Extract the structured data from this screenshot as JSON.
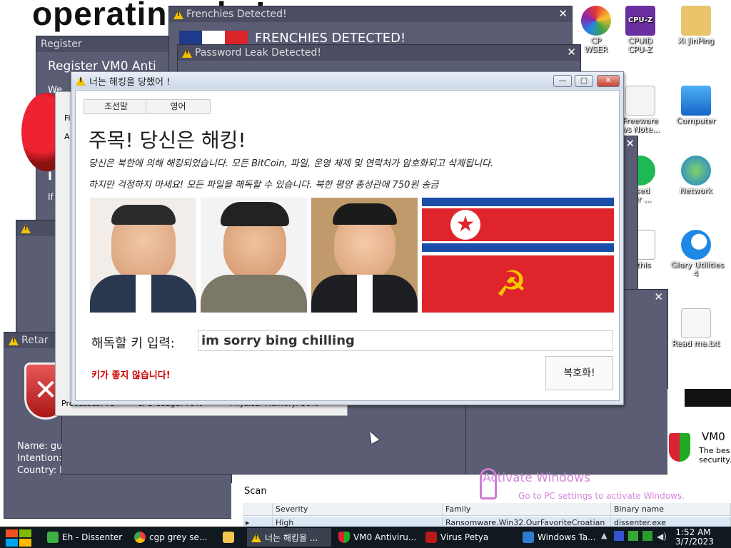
{
  "background_title": "operatin                     ucks!",
  "desktop_icons": [
    {
      "label": "CP\nWSER",
      "icon": "browser-icon"
    },
    {
      "label": "CPUID\nCPU-Z",
      "icon": "cpuz-icon"
    },
    {
      "label": "Xi JinPing",
      "icon": "folder-user-icon"
    },
    {
      "label": "Freeware\nws Note...",
      "icon": "document-icon"
    },
    {
      "label": "Computer",
      "icon": "computer-icon"
    },
    {
      "label": "used\nser ...",
      "icon": "spotify-icon"
    },
    {
      "label": "Network",
      "icon": "network-icon"
    },
    {
      "label": "s this",
      "icon": "file-icon"
    },
    {
      "label": "Glary Utilities\n4",
      "icon": "glary-icon"
    },
    {
      "label": "Read me.txt",
      "icon": "text-file-icon"
    }
  ],
  "windows": {
    "frenchies": {
      "title": "Frenchies Detected!",
      "banner": "FRENCHIES DETECTED!"
    },
    "password": {
      "title": "Password Leak Detected!"
    },
    "register": {
      "title": "Register",
      "heading": "Register VM0 Anti",
      "line1": "We",
      "f": "F",
      "k": "K",
      "i": "I",
      "if": "If"
    },
    "retarded": {
      "title": "Retar",
      "name_label": "Name: gu",
      "intention_label": "Intention:",
      "country_label": "Country: F"
    },
    "taskman": {
      "fi": "Fi",
      "a": "A",
      "processes": "Processes: 73",
      "cpu": "CPU Usage: 79%",
      "mem": "Physical Memory: 56%"
    }
  },
  "main": {
    "title": "너는 해킹을 당했어 !",
    "btn_minimize": "—",
    "btn_maximize": "▢",
    "btn_close": "✕",
    "lang_korean": "조선말",
    "lang_english": "영어",
    "heading": "주목! 당신은 해킹!",
    "para1": "당신은 북한에 의해 해킹되었습니다. 모든 BitCoin, 파일, 운영 체제 및 연락처가 암호화되고 삭제됩니다.",
    "para2": "하지만 걱정하지 마세요! 모든 파일을 해독할 수 있습니다. 북한 평양 총성관에 750원 송금",
    "key_label": "해독할 키 입력:",
    "key_value": "im sorry bing chilling",
    "error_text": "키가 좋지 않습니다!",
    "decrypt_button": "복호화!"
  },
  "vm0_popup": {
    "title": "VM0",
    "line1": "The bes",
    "line2": "security."
  },
  "scan_panel": {
    "tab": "Scan",
    "columns": [
      "Severity",
      "Family",
      "Binary name"
    ],
    "rows": [
      [
        "High",
        "Ransomware.Win32.OurFavoriteCroatian",
        "dissenter.exe"
      ]
    ]
  },
  "watermark": {
    "line1": "Activate Windows",
    "line2": "Go to PC settings to activate Windows."
  },
  "taskbar": {
    "items": [
      {
        "label": "Eh - Dissenter",
        "icon": "dissenter-icon"
      },
      {
        "label": "cgp grey se...",
        "icon": "chrome-icon"
      },
      {
        "label": "",
        "icon": "folder-icon"
      },
      {
        "label": "너는 해킹을 ...",
        "icon": "warning-icon"
      },
      {
        "label": "VM0 Antiviru...",
        "icon": "shield-icon"
      },
      {
        "label": "Virus Petya",
        "icon": "petya-icon"
      },
      {
        "label": "Windows Ta...",
        "icon": "taskmanager-icon"
      }
    ],
    "time": "1:52 AM",
    "date": "3/7/2023"
  }
}
